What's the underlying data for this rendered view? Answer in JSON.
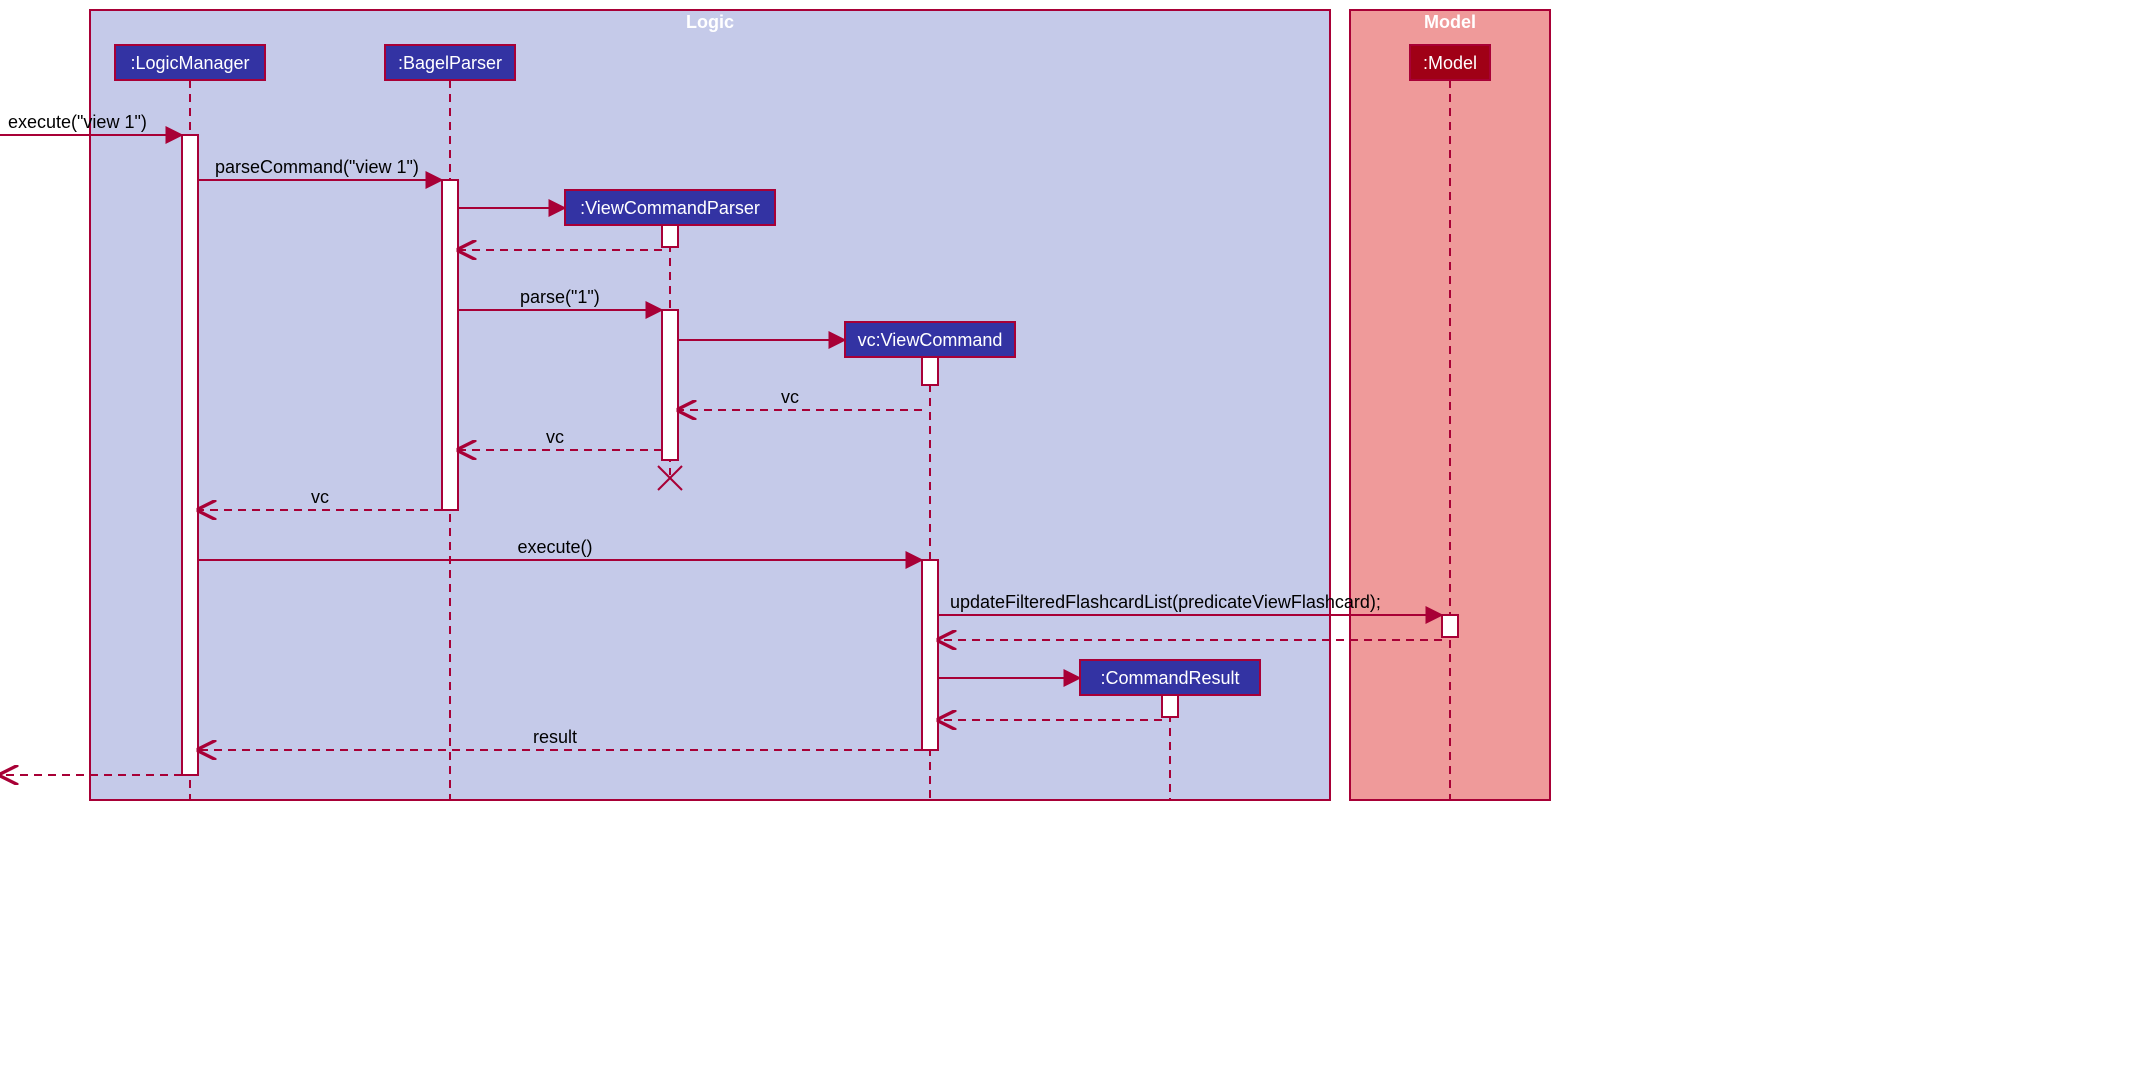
{
  "frames": {
    "logic": "Logic",
    "model": "Model"
  },
  "lifelines": {
    "logicManager": ":LogicManager",
    "bagelParser": ":BagelParser",
    "viewCommandParser": ":ViewCommandParser",
    "viewCommand": "vc:ViewCommand",
    "commandResult": ":CommandResult",
    "model": ":Model"
  },
  "messages": {
    "executeIn": "execute(\"view 1\")",
    "parseCommand": "parseCommand(\"view 1\")",
    "parse": "parse(\"1\")",
    "vc1": "vc",
    "vc2": "vc",
    "vc3": "vc",
    "execute": "execute()",
    "updateFiltered": "updateFilteredFlashcardList(predicateViewFlashcard);",
    "result": "result"
  },
  "colors": {
    "logicBg": "#c5cae9",
    "modelBg": "#ef9a9a",
    "boxBlue": "#3333a3",
    "boxDarkRed": "#a00016",
    "line": "#a80036"
  }
}
